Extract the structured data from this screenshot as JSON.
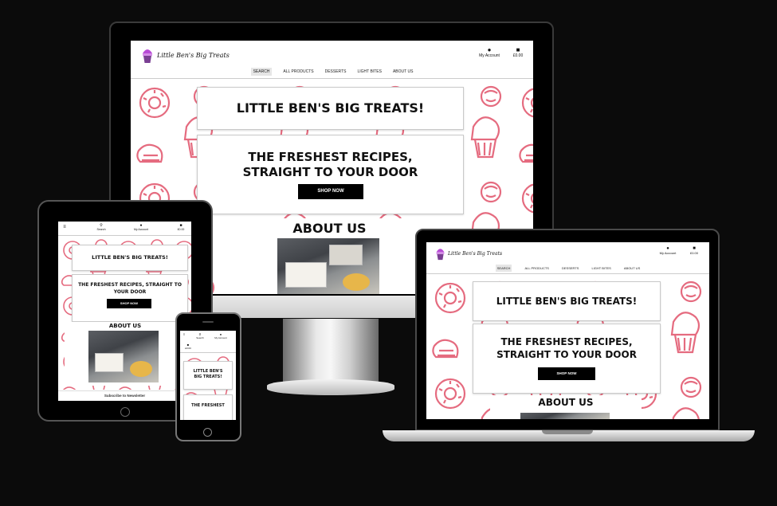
{
  "site": {
    "logo_text": "Little Ben's Big Treats",
    "nav": [
      "SEARCH",
      "ALL PRODUCTS",
      "DESSERTS",
      "LIGHT BITES",
      "ABOUT US"
    ],
    "account_label": "My Account",
    "basket_total": "£0.00",
    "search_label": "Search",
    "hero_title": "LITTLE BEN'S BIG TREATS!",
    "tagline": "THE FRESHEST RECIPES, STRAIGHT TO YOUR DOOR",
    "shop_button": "SHOP NOW",
    "about_heading": "ABOUT US",
    "newsletter": "Subscribe to Newsletter"
  },
  "mobile": {
    "hero_line1": "LITTLE BEN'S",
    "hero_line2": "BIG TREATS!",
    "tagline_part": "THE FRESHEST"
  },
  "colors": {
    "background": "#0b0b0b",
    "pattern": "#e56b7f",
    "button": "#000000",
    "logo_cupcake": "#b84bd6"
  }
}
